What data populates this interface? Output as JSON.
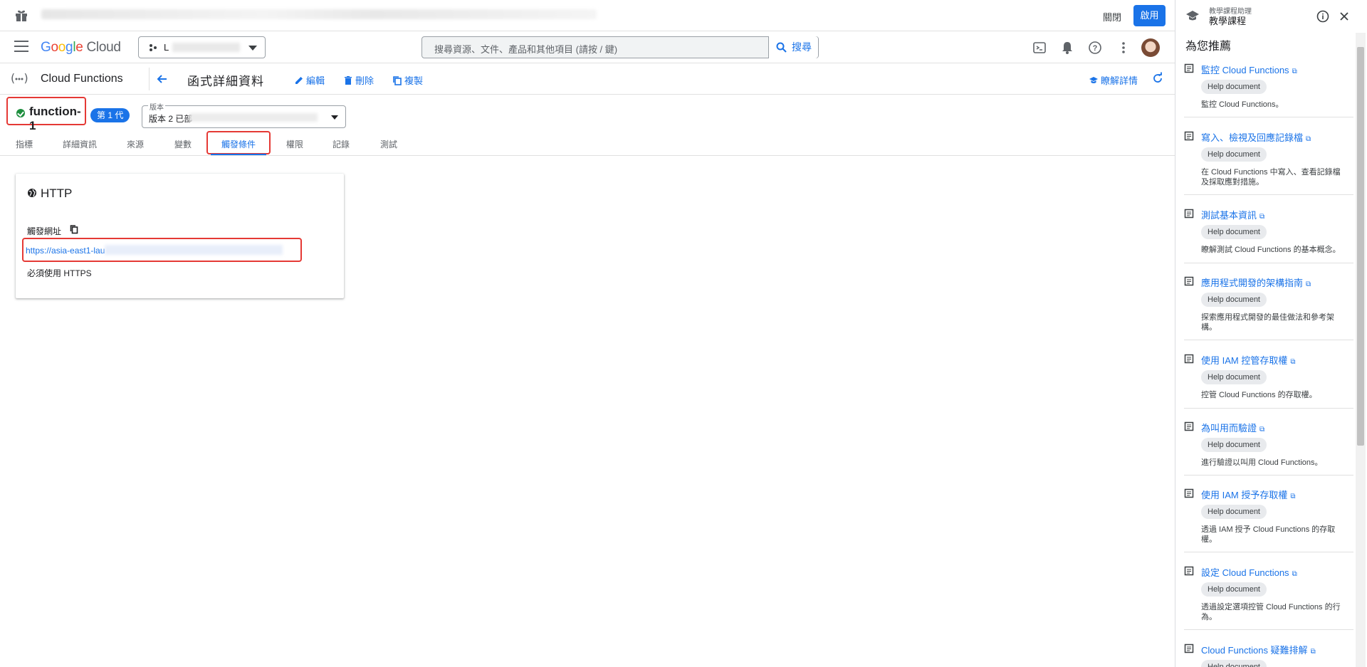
{
  "promo": {
    "dismiss": "關閉",
    "activate": "啟用"
  },
  "topbar": {
    "logo": {
      "g1": "G",
      "g2": "o",
      "g3": "o",
      "g4": "g",
      "g5": "l",
      "g6": "e",
      "cloud": " Cloud"
    },
    "project_name": "L",
    "search_placeholder": "搜尋資源、文件、產品和其他項目 (請按 / 鍵)",
    "search_button": "搜尋"
  },
  "header": {
    "service": "Cloud Functions",
    "title": "函式詳細資料",
    "actions": {
      "edit": "編輯",
      "delete": "刪除",
      "copy": "複製"
    },
    "learn": "瞭解詳情"
  },
  "function": {
    "name": "function-1",
    "generation": "第 1 代",
    "version_label": "版本",
    "version_value": "版本 2 已部"
  },
  "tabs": [
    "指標",
    "詳細資訊",
    "來源",
    "變數",
    "觸發條件",
    "權限",
    "記錄",
    "測試"
  ],
  "active_tab": "觸發條件",
  "trigger": {
    "type": "HTTP",
    "url_label": "觸發網址",
    "url": "https://asia-east1-lau",
    "https_note": "必須使用 HTTPS"
  },
  "panel": {
    "subtitle": "教學課程助理",
    "title": "教學課程",
    "heading": "為您推薦",
    "items": [
      {
        "link": "監控 Cloud Functions",
        "chip": "Help document",
        "desc": "監控 Cloud Functions。"
      },
      {
        "link": "寫入、檢視及回應記錄檔",
        "chip": "Help document",
        "desc": "在 Cloud Functions 中寫入、查看記錄檔及採取應對措施。"
      },
      {
        "link": "測試基本資訊",
        "chip": "Help document",
        "desc": "瞭解測試 Cloud Functions 的基本概念。"
      },
      {
        "link": "應用程式開發的架構指南",
        "chip": "Help document",
        "desc": "探索應用程式開發的最佳做法和參考架構。"
      },
      {
        "link": "使用 IAM 控管存取權",
        "chip": "Help document",
        "desc": "控管 Cloud Functions 的存取權。"
      },
      {
        "link": "為叫用而驗證",
        "chip": "Help document",
        "desc": "進行驗證以叫用 Cloud Functions。"
      },
      {
        "link": "使用 IAM 授予存取權",
        "chip": "Help document",
        "desc": "透過 IAM 授予 Cloud Functions 的存取權。"
      },
      {
        "link": "設定 Cloud Functions",
        "chip": "Help document",
        "desc": "透過設定選項控管 Cloud Functions 的行為。"
      },
      {
        "link": "Cloud Functions 疑難排解",
        "chip": "Help document",
        "desc": ""
      }
    ]
  }
}
